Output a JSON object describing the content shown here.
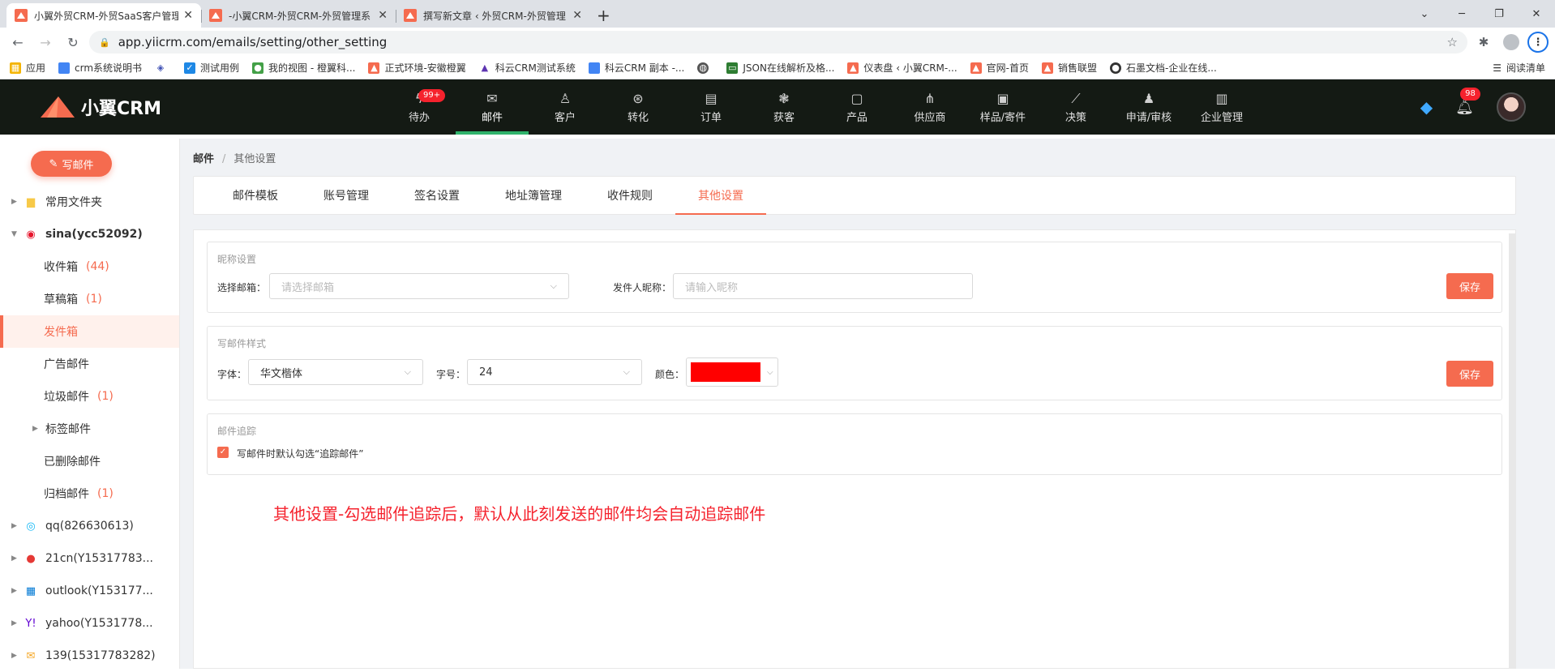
{
  "browser": {
    "tabs": [
      {
        "title": "小翼外贸CRM-外贸SaaS客户管理",
        "active": true
      },
      {
        "title": "-小翼CRM-外贸CRM-外贸管理系",
        "active": false
      },
      {
        "title": "撰写新文章 ‹ 外贸CRM-外贸管理",
        "active": false
      }
    ],
    "url": "app.yiicrm.com/emails/setting/other_setting",
    "bookmarks": [
      "应用",
      "crm系统说明书",
      "",
      "测试用例",
      "我的视图 - 橙翼科...",
      "正式环境-安徽橙翼",
      "科云CRM测试系统",
      "科云CRM 副本 -...",
      "",
      "JSON在线解析及格...",
      "仪表盘 ‹ 小翼CRM-...",
      "官网-首页",
      "销售联盟",
      "石墨文档-企业在线..."
    ],
    "reading_list": "阅读清单"
  },
  "app": {
    "logo_text": "小翼CRM",
    "nav": [
      {
        "label": "待办",
        "icon": "bolt-icon",
        "badge": "99+"
      },
      {
        "label": "邮件",
        "icon": "mail-icon",
        "active": true
      },
      {
        "label": "客户",
        "icon": "user-icon"
      },
      {
        "label": "转化",
        "icon": "convert-icon"
      },
      {
        "label": "订单",
        "icon": "order-icon"
      },
      {
        "label": "获客",
        "icon": "acquire-icon"
      },
      {
        "label": "产品",
        "icon": "product-icon"
      },
      {
        "label": "供应商",
        "icon": "supplier-icon"
      },
      {
        "label": "样品/寄件",
        "icon": "sample-icon"
      },
      {
        "label": "决策",
        "icon": "decision-icon"
      },
      {
        "label": "申请/审核",
        "icon": "approve-icon"
      },
      {
        "label": "企业管理",
        "icon": "company-icon"
      }
    ],
    "notification_badge": "98",
    "accent_color": "#f56b4f",
    "header_bg": "#141a14"
  },
  "sidebar": {
    "compose": "写邮件",
    "items": [
      {
        "label": "常用文件夹",
        "count": ""
      },
      {
        "label": "sina(ycc52092)",
        "count": ""
      },
      {
        "label": "收件箱",
        "count": "(44)"
      },
      {
        "label": "草稿箱",
        "count": "(1)"
      },
      {
        "label": "发件箱",
        "count": ""
      },
      {
        "label": "广告邮件",
        "count": ""
      },
      {
        "label": "垃圾邮件",
        "count": "(1)"
      },
      {
        "label": "标签邮件",
        "count": ""
      },
      {
        "label": "已删除邮件",
        "count": ""
      },
      {
        "label": "归档邮件",
        "count": "(1)"
      },
      {
        "label": "qq(826630613)",
        "count": ""
      },
      {
        "label": "21cn(Y15317783...",
        "count": ""
      },
      {
        "label": "outlook(Y153177...",
        "count": ""
      },
      {
        "label": "yahoo(Y1531778...",
        "count": ""
      },
      {
        "label": "139(15317783282)",
        "count": ""
      }
    ]
  },
  "breadcrumb": {
    "root": "邮件",
    "sep": "/",
    "current": "其他设置"
  },
  "settings_tabs": [
    "邮件模板",
    "账号管理",
    "签名设置",
    "地址簿管理",
    "收件规则",
    "其他设置"
  ],
  "nickname": {
    "title": "昵称设置",
    "email_label": "选择邮箱：",
    "email_placeholder": "请选择邮箱",
    "nick_label": "发件人昵称：",
    "nick_placeholder": "请输入昵称",
    "save": "保存"
  },
  "style": {
    "title": "写邮件样式",
    "font_label": "字体：",
    "font_value": "华文楷体",
    "size_label": "字号：",
    "size_value": "24",
    "color_label": "颜色：",
    "color_value": "#ff0000",
    "save": "保存"
  },
  "tracking": {
    "title": "邮件追踪",
    "checkbox_label": "写邮件时默认勾选“追踪邮件”",
    "checked": true
  },
  "annotation": "其他设置-勾选邮件追踪后，默认从此刻发送的邮件均会自动追踪邮件"
}
